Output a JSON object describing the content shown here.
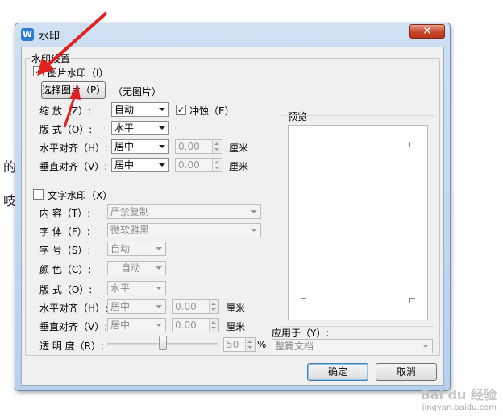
{
  "background": {
    "text_1": "的",
    "text_2": "吱"
  },
  "window": {
    "title": "水印",
    "icon": "W",
    "close_label": "×"
  },
  "group": {
    "title": "水印设置"
  },
  "picture": {
    "checkbox_label": "图片水印（I）:",
    "checked": "✓",
    "select_button": "选择图片（P）",
    "status": "（无图片）",
    "scale_label": "缩   放（Z）:",
    "scale_value": "自动",
    "washout_checked": "✓",
    "washout_label": "冲蚀（E）",
    "layout_label": "版   式（O）:",
    "layout_value": "水平",
    "halign_label": "水平对齐（H）:",
    "halign_value": "居中",
    "halign_num": "0.00",
    "valign_label": "垂直对齐（V）:",
    "valign_value": "居中",
    "valign_num": "0.00",
    "unit": "厘米"
  },
  "text_watermark": {
    "checkbox_label": "文字水印（X）",
    "content_label": "内   容（T）:",
    "content_value": "严禁复制",
    "font_label": "字   体（F）:",
    "font_value": "微软雅黑",
    "size_label": "字   号（S）:",
    "size_value": "自动",
    "color_label": "颜   色（C）:",
    "color_value": "自动",
    "layout_label": "版   式（O）:",
    "layout_value": "水平",
    "halign_label": "水平对齐（H）:",
    "halign_value": "居中",
    "halign_num": "0.00",
    "valign_label": "垂直对齐（V）:",
    "valign_value": "居中",
    "valign_num": "0.00",
    "unit": "厘米",
    "opacity_label": "透 明 度（R）:",
    "opacity_value": "50",
    "opacity_unit": "%"
  },
  "preview": {
    "label": "预览"
  },
  "apply": {
    "label": "应用于（Y）:",
    "value": "整篇文档"
  },
  "buttons": {
    "ok": "确定",
    "cancel": "取消"
  },
  "watermark_overlay": {
    "brand": "Bai du 经验",
    "url": "jingyan.baidu.com"
  }
}
